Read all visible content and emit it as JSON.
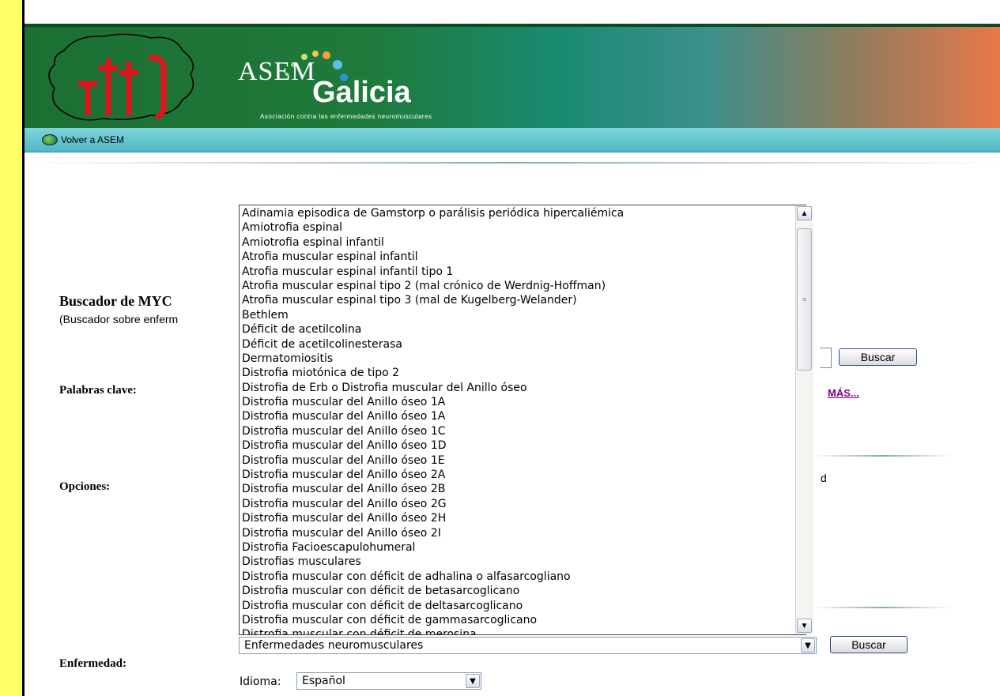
{
  "header": {
    "brand_asem": "ASEM",
    "brand_galicia": "Galicia",
    "tagline": "Asociación contra las enfermedades neuromusculares"
  },
  "nav": {
    "back_label": "Volver a ASEM"
  },
  "search": {
    "title": "Buscador de MYC",
    "subtitle": "(Buscador sobre enferm",
    "keywords_label": "Palabras clave:",
    "options_label": "Opciones:",
    "disease_label": "Enfermedad:",
    "search_button": "Buscar",
    "search_button_2": "Buscar",
    "more_link": "MÁS...",
    "options_trailing": "d",
    "disease_select_value": "Enfermedades neuromusculares",
    "language_label": "Idioma:",
    "language_value": "Español"
  },
  "dropdown": {
    "items": [
      "Adinamia episodica de Gamstorp o parálisis periódica hipercaliémica",
      "Amiotrofia espinal",
      "Amiotrofia espinal infantil",
      "Atrofia muscular espinal infantil",
      "Atrofia muscular espinal infantil tipo 1",
      "Atrofia muscular espinal tipo 2 (mal crónico de Werdnig-Hoffman)",
      "Atrofia muscular espinal tipo 3 (mal de Kugelberg-Welander)",
      "Bethlem",
      "Déficit de acetilcolina",
      "Déficit de acetilcolinesterasa",
      "Dermatomiositis",
      "Distrofia miotónica de tipo 2",
      "Distrofia de Erb o Distrofia muscular del Anillo óseo",
      "Distrofia muscular del Anillo óseo 1A",
      "Distrofia muscular del Anillo óseo 1A",
      "Distrofia muscular del Anillo óseo 1C",
      "Distrofia muscular del Anillo óseo 1D",
      "Distrofia muscular del Anillo óseo 1E",
      "Distrofia muscular del Anillo óseo 2A",
      "Distrofia muscular del Anillo óseo 2B",
      "Distrofia muscular del Anillo óseo 2G",
      "Distrofia muscular del Anillo óseo 2H",
      "Distrofia muscular del Anillo óseo 2I",
      "Distrofia Facioescapulohumeral",
      "Distrofias musculares",
      "Distrofia muscular con déficit de adhalina o alfasarcogliano",
      "Distrofia muscular con déficit de betasarcoglicano",
      "Distrofia muscular con déficit de deltasarcoglicano",
      "Distrofia muscular con déficit de gammasarcoglicano",
      "Distrofia muscular con déficit de merosina"
    ]
  }
}
